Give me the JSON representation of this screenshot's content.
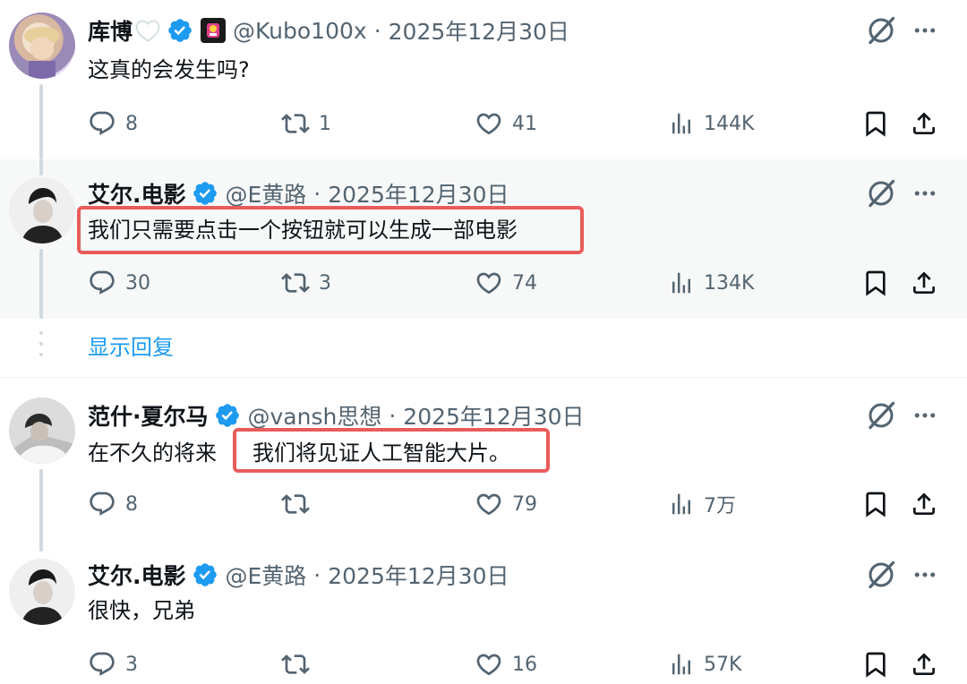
{
  "tweets": [
    {
      "name": "库博",
      "handle": "@Kubo100x",
      "separator": "·",
      "date": "2025年12月30日",
      "text": "这真的会发生吗?",
      "replies": "8",
      "reposts": "1",
      "likes": "41",
      "views": "144K"
    },
    {
      "name": "艾尔.电影",
      "handle": "@E黄路",
      "separator": "·",
      "date": "2025年12月30日",
      "text": "我们只需要点击一个按钮就可以生成一部电影",
      "replies": "30",
      "reposts": "3",
      "likes": "74",
      "views": "134K"
    },
    {
      "name": "范什·夏尔马",
      "handle": "@vansh思想",
      "separator": "·",
      "date": "2025年12月30日",
      "text_prefix": "在不久的将来",
      "text_highlight": "我们将见证人工智能大片。",
      "replies": "8",
      "reposts": "",
      "likes": "79",
      "views": "7万"
    },
    {
      "name": "艾尔.电影",
      "handle": "@E黄路",
      "separator": "·",
      "date": "2025年12月30日",
      "text": "很快，兄弟",
      "replies": "3",
      "reposts": "",
      "likes": "16",
      "views": "57K"
    }
  ],
  "show_replies_label": "显示回复",
  "colors": {
    "verified": "#1d9bf0",
    "highlight_border": "#ea5b5b",
    "muted": "#536471",
    "link": "#1d9bf0"
  },
  "icons": [
    "reply-icon",
    "repost-icon",
    "like-icon",
    "views-icon",
    "bookmark-icon",
    "share-icon",
    "grok-icon",
    "more-icon",
    "verified-icon"
  ]
}
